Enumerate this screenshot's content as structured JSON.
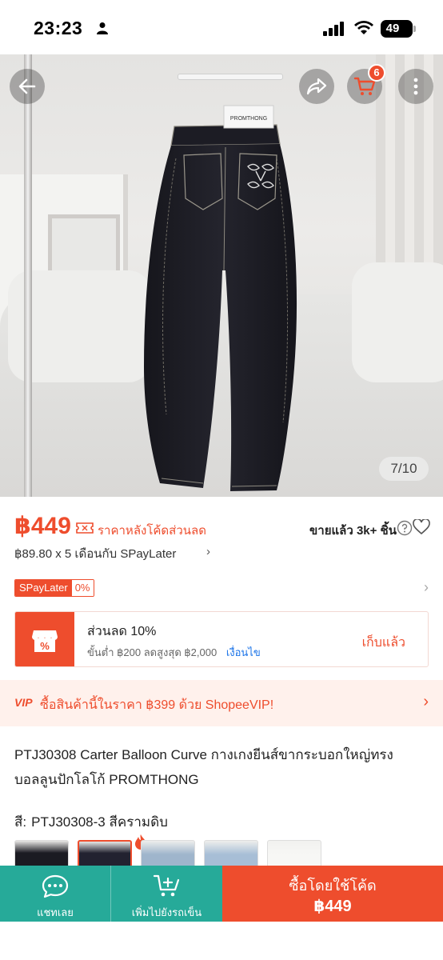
{
  "status_bar": {
    "time": "23:23",
    "battery": "49"
  },
  "photo": {
    "counter": "7/10",
    "cart_count": "6",
    "brand_tag": "PROMTHONG"
  },
  "price": {
    "current": "฿449",
    "note": "ราคาหลังโค้ดส่วนลด",
    "sold": "ขายแล้ว 3k+ ชิ้น",
    "installment": "฿89.80 x 5 เดือนกับ SPayLater",
    "installment_chevron": "›"
  },
  "spaylater": {
    "name": "SPayLater",
    "rate": "0%",
    "chevron": "›"
  },
  "voucher": {
    "title": "ส่วนลด 10%",
    "desc": "ขั้นต่ำ ฿200 ลดสูงสุด ฿2,000",
    "condition": "เงื่อนไข",
    "status": "เก็บแล้ว"
  },
  "vip": {
    "badge": "VIP",
    "text": "ซื้อสินค้านี้ในราคา ฿399 ด้วย ShopeeVIP!",
    "chevron": "›"
  },
  "product": {
    "title": "PTJ30308 Carter Balloon Curve กางเกงยีนส์ขากระบอกใหญ่ทรงบอลลูนปักโลโก้ PROMTHONG",
    "variant_key": "สี:",
    "variant_value": "PTJ30308-3 สีครามดิบ"
  },
  "bottom_bar": {
    "chat_label": "แชทเลย",
    "cart_label": "เพิ่มไปยังรถเข็น",
    "buy_title": "ซื้อโดยใช้โค้ด",
    "buy_price": "฿449"
  },
  "colors": {
    "accent": "#ee4d2d",
    "teal": "#26aa99",
    "link": "#1a73e8"
  }
}
